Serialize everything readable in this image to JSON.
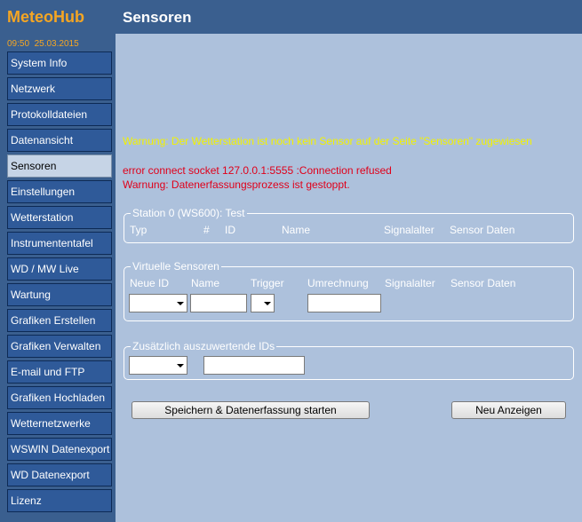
{
  "sidebar": {
    "brand": "MeteoHub",
    "datetime": "09:50  25.03.2015",
    "items": [
      {
        "label": "System Info"
      },
      {
        "label": "Netzwerk"
      },
      {
        "label": "Protokolldateien"
      },
      {
        "label": "Datenansicht"
      },
      {
        "label": "Sensoren",
        "active": true
      },
      {
        "label": "Einstellungen"
      },
      {
        "label": "Wetterstation"
      },
      {
        "label": "Instrumententafel"
      },
      {
        "label": "WD / MW Live"
      },
      {
        "label": "Wartung"
      },
      {
        "label": "Grafiken Erstellen"
      },
      {
        "label": "Grafiken Verwalten"
      },
      {
        "label": "E-mail und FTP"
      },
      {
        "label": "Grafiken Hochladen"
      },
      {
        "label": "Wetternetzwerke"
      },
      {
        "label": "WSWIN Datenexport"
      },
      {
        "label": "WD Datenexport"
      },
      {
        "label": "Lizenz"
      }
    ]
  },
  "header": {
    "title": "Sensoren"
  },
  "messages": {
    "warning": "Warnung: Der Wetterstation ist noch kein Sensor auf der Seite \"Sensoren\" zugewiesen",
    "error": "error connect socket 127.0.0.1:5555 :Connection refused",
    "stopped": "Warnung: Datenerfassungsprozess ist gestoppt."
  },
  "station": {
    "legend": "Station 0 (WS600): Test",
    "columns": [
      "Typ",
      "#",
      "ID",
      "Name",
      "Signalalter",
      "Sensor Daten"
    ]
  },
  "virtual": {
    "legend": "Virtuelle Sensoren",
    "columns": [
      "Neue ID",
      "Name",
      "Trigger",
      "Umrechnung",
      "Signalalter",
      "Sensor Daten"
    ]
  },
  "extra": {
    "legend": "Zusätzlich auszuwertende IDs"
  },
  "buttons": {
    "save": "Speichern & Datenerfassung starten",
    "refresh": "Neu Anzeigen"
  },
  "colors": {
    "sidebar_bg": "#3a5f8f",
    "nav_item": "#2f5a99",
    "nav_active": "#c6d4e6",
    "brand": "#f5a623",
    "content_bg": "#adc1dc",
    "warning": "#f2f200",
    "error": "#e0001a"
  }
}
